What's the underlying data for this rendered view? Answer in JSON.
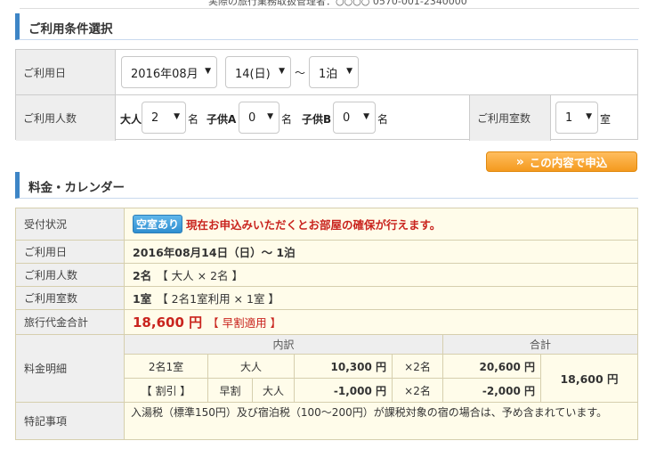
{
  "top_cut_text": "実際の旅行業務取扱管理者：○○○○ 0570-001-2340000",
  "conditions": {
    "section_title": "ご利用条件選択",
    "date_label": "ご利用日",
    "year_month": "2016年08月",
    "day": "14(日)",
    "tilde": "～",
    "nights": "1泊",
    "persons_label": "ご利用人数",
    "adult_label": "大人",
    "adult_value": "2",
    "name_unit": "名",
    "childA_label": "子供A",
    "childA_value": "0",
    "childB_label": "子供B",
    "childB_value": "0",
    "rooms_label": "ご利用室数",
    "rooms_value": "1",
    "rooms_unit": "室"
  },
  "apply_button": {
    "chevron": "»",
    "label": "この内容で申込"
  },
  "calendar": {
    "section_title": "料金・カレンダー"
  },
  "info": {
    "status_label": "受付状況",
    "status_badge": "空室あり",
    "status_message": "現在お申込みいただくとお部屋の確保が行えます。",
    "date_label": "ご利用日",
    "date_value": "2016年08月14日（日）～ 1泊",
    "persons_label": "ご利用人数",
    "persons_main": "2名",
    "persons_detail": "【 大人 × 2名 】",
    "rooms_label": "ご利用室数",
    "rooms_main": "1室",
    "rooms_detail": "【 2名1室利用 × 1室 】",
    "total_label": "旅行代金合計",
    "total_price": "18,600 円",
    "total_note": "【 早割適用 】",
    "breakdown_label": "料金明細",
    "breakdown_header_items": "内訳",
    "breakdown_header_sum": "合計",
    "row1": {
      "room": "2名1室",
      "type": "大人",
      "price": "10,300 円",
      "qty": "×2名",
      "subtotal": "20,600 円"
    },
    "row2": {
      "room": "【 割引 】",
      "kind": "早割",
      "type": "大人",
      "price": "-1,000 円",
      "qty": "×2名",
      "subtotal": "-2,000 円"
    },
    "grand_total": "18,600 円",
    "notes_label": "特記事項",
    "notes_text": "入湯税（標準150円）及び宿泊税（100～200円）が課税対象の宿の場合は、予め含まれています。"
  }
}
